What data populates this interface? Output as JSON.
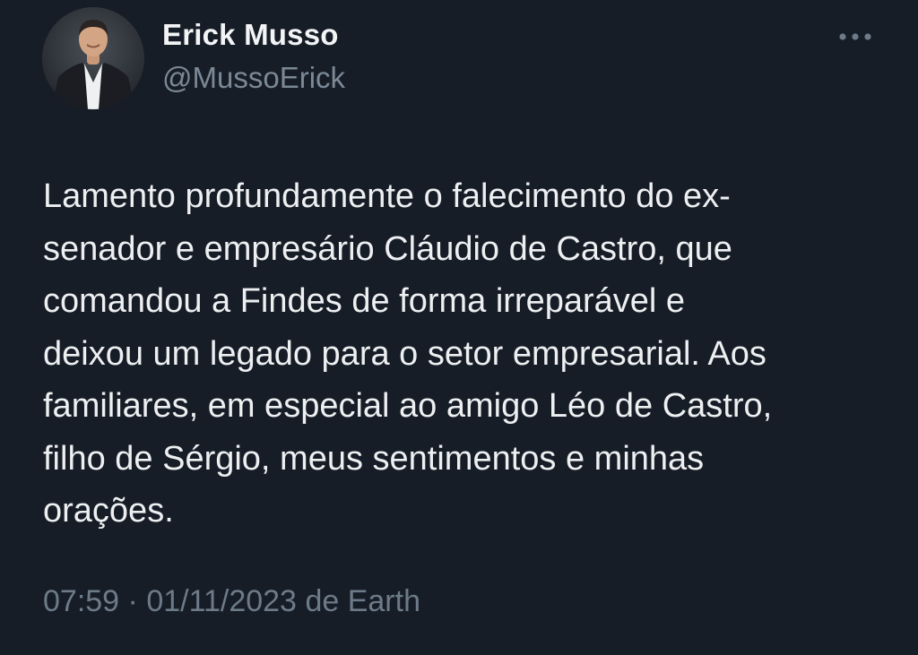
{
  "author": {
    "display_name": "Erick Musso",
    "handle": "@MussoErick",
    "avatar_icon": "profile-photo"
  },
  "more_icon": "more-horizontal-icon",
  "tweet": {
    "lines": [
      "Lamento profundamente o falecimento do ex-",
      "senador e empresário Cláudio de Castro, que",
      "comandou a Findes de forma irreparável e",
      "deixou um legado para o setor empresarial. Aos",
      "familiares, em especial ao amigo Léo de Castro,",
      "filho de Sérgio, meus sentimentos e minhas",
      "orações."
    ]
  },
  "meta": {
    "time": "07:59",
    "separator": "·",
    "date": "01/11/2023",
    "source_prefix": "de",
    "source": "Earth"
  },
  "colors": {
    "background": "#161d27",
    "text": "#edeff1",
    "secondary": "#6d7a88"
  }
}
